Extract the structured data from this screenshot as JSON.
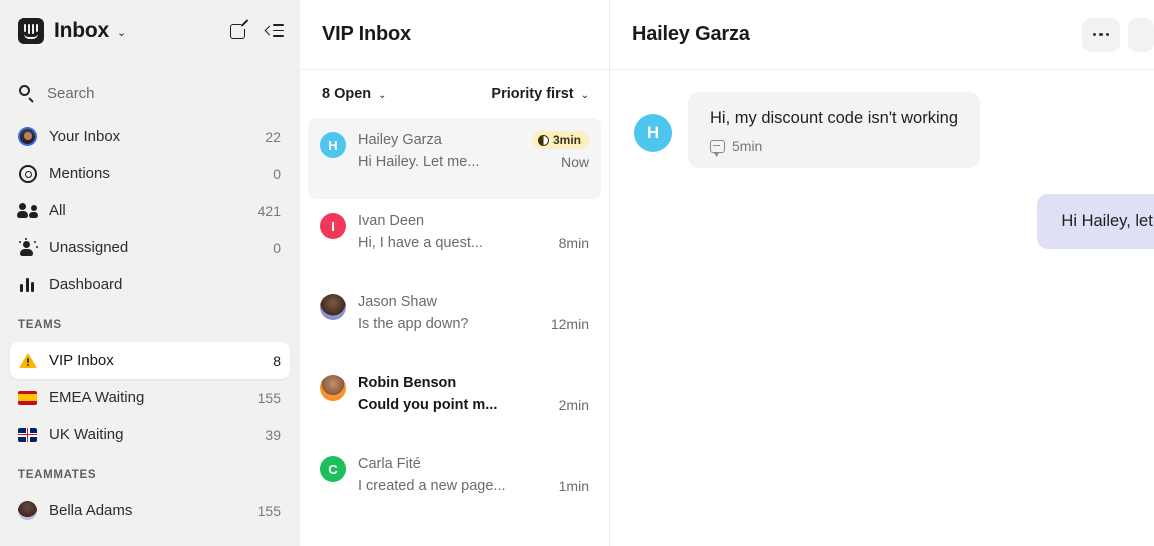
{
  "sidebar": {
    "logo_icon": "intercom-logo-icon",
    "title": "Inbox",
    "title_chevron": "⌄",
    "compose_icon": "compose-icon",
    "collapse_icon": "collapse-sidebar-icon",
    "search": {
      "icon": "search-icon",
      "placeholder": "Search"
    },
    "nav": [
      {
        "label": "Your Inbox",
        "count": "22",
        "icon": "user-avatar-icon"
      },
      {
        "label": "Mentions",
        "count": "0",
        "icon": "at-mention-icon"
      },
      {
        "label": "All",
        "count": "421",
        "icon": "people-icon"
      },
      {
        "label": "Unassigned",
        "count": "0",
        "icon": "unassigned-person-icon"
      },
      {
        "label": "Dashboard",
        "count": "",
        "icon": "bar-chart-icon"
      }
    ],
    "teams_header": "TEAMS",
    "teams": [
      {
        "label": "VIP Inbox",
        "count": "8",
        "icon": "warning-triangle-icon",
        "selected": true
      },
      {
        "label": "EMEA Waiting",
        "count": "155",
        "icon": "spain-flag-icon",
        "selected": false
      },
      {
        "label": "UK Waiting",
        "count": "39",
        "icon": "uk-flag-icon",
        "selected": false
      }
    ],
    "teammates_header": "TEAMMATES",
    "teammates": [
      {
        "label": "Bella Adams",
        "count": "155",
        "icon": "avatar-icon"
      }
    ]
  },
  "list": {
    "title": "VIP Inbox",
    "filter_status": "8 Open",
    "filter_status_chevron": "⌄",
    "filter_sort": "Priority first",
    "filter_sort_chevron": "⌄",
    "conversations": [
      {
        "name": "Hailey Garza",
        "preview": "Hi Hailey. Let me...",
        "time": "Now",
        "initial": "H",
        "avatar_color": "#4ec5ef",
        "avatar_type": "initial",
        "sla_badge": "3min",
        "unread": false,
        "active": true
      },
      {
        "name": "Ivan Deen",
        "preview": "Hi, I have a quest...",
        "time": "8min",
        "initial": "I",
        "avatar_color": "#f0385b",
        "avatar_type": "initial",
        "sla_badge": "",
        "unread": false,
        "active": false
      },
      {
        "name": "Jason Shaw",
        "preview": "Is the app down?",
        "time": "12min",
        "initial": "",
        "avatar_color": "",
        "avatar_type": "photo-jason",
        "sla_badge": "",
        "unread": false,
        "active": false
      },
      {
        "name": "Robin Benson",
        "preview": "Could you point m...",
        "time": "2min",
        "initial": "",
        "avatar_color": "",
        "avatar_type": "photo-robin",
        "sla_badge": "",
        "unread": true,
        "active": false
      },
      {
        "name": "Carla Fité",
        "preview": "I created a new page...",
        "time": "1min",
        "initial": "C",
        "avatar_color": "#1ebe5d",
        "avatar_type": "initial",
        "sla_badge": "",
        "unread": false,
        "active": false
      }
    ]
  },
  "conversation": {
    "title": "Hailey Garza",
    "more_icon": "ellipsis-icon",
    "messages": [
      {
        "direction": "incoming",
        "avatar_initial": "H",
        "avatar_color": "#4ec5ef",
        "text": "Hi, my discount code isn't working",
        "meta_icon": "chat-bubble-icon",
        "meta_time": "5min"
      },
      {
        "direction": "outgoing",
        "text": "Hi Hailey, let me check"
      }
    ]
  },
  "colors": {
    "sidebar_bg": "#f1f1f0",
    "selected_row": "#f5f4f6",
    "sla_badge_bg": "#fcf1be",
    "outgoing_bubble": "#dfdff6",
    "incoming_bubble": "#f3f3f3",
    "accent_cyan": "#4ec5ef"
  }
}
